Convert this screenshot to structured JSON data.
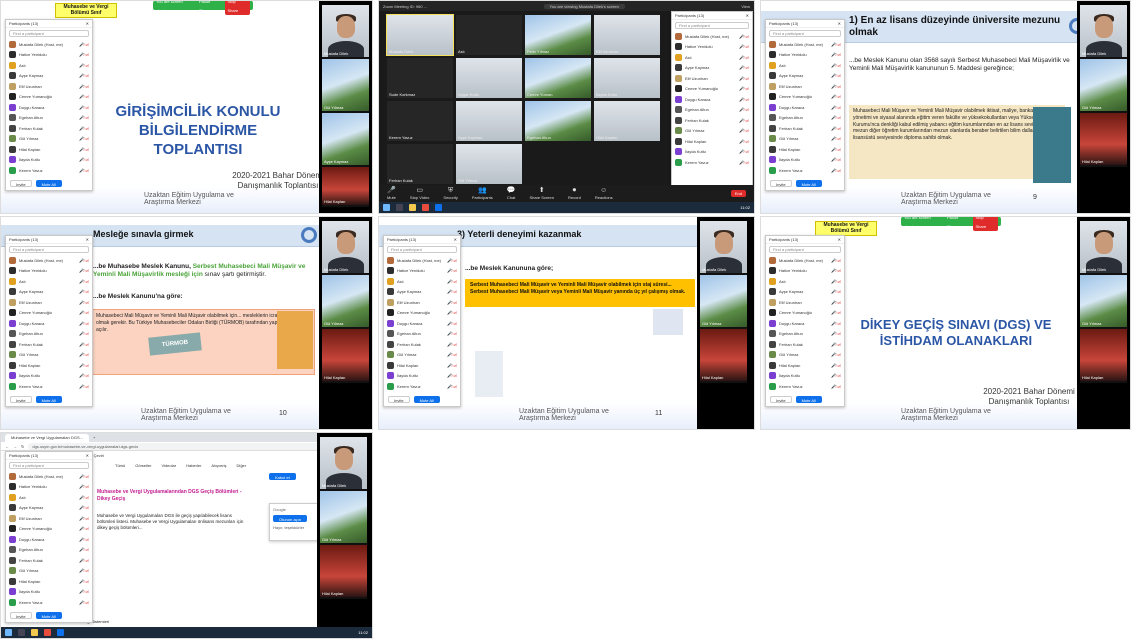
{
  "share_bar": {
    "sharing_label": "You are screen sharing",
    "pause_label": "Pause Share",
    "stop_label": "Stop Share"
  },
  "participants_panel": {
    "title": "Participants (13)",
    "search_placeholder": "Find a participant",
    "invite_label": "Invite",
    "mute_all_label": "Mute All",
    "rows": [
      {
        "name": "Mustafa Dilek (Host, me)",
        "color": "#b36a3a"
      },
      {
        "name": "Hatice Yenidolu",
        "color": "#2d2d2d"
      },
      {
        "name": "Aslı",
        "color": "#e0a020"
      },
      {
        "name": "Ayşe Kaymaz",
        "color": "#3a3a3a"
      },
      {
        "name": "Elif Uzunhan",
        "color": "#c0a060"
      },
      {
        "name": "Cemre Yumanoğlu",
        "color": "#222222"
      },
      {
        "name": "Duygu Karaca",
        "color": "#7a3ed1"
      },
      {
        "name": "Egehan Altun",
        "color": "#555555"
      },
      {
        "name": "Ferhan Kulak",
        "color": "#444444"
      },
      {
        "name": "Gül Yılmaz",
        "color": "#6a8a4a"
      },
      {
        "name": "Hilal Kaplan",
        "color": "#3a3a3a"
      },
      {
        "name": "İlayda Kutlu",
        "color": "#7a3ed1"
      },
      {
        "name": "Kerem Yavuz",
        "color": "#2a9d4a"
      }
    ]
  },
  "videos": {
    "host_name": "Mustafa Dilek",
    "second_name": "Ayşe Kaymaz",
    "third_name": "Hilal Kaplan",
    "fourth_name": "Gül Yılmaz"
  },
  "slides": {
    "s1": {
      "header": "Muhasebe ve Vergi Bölümü Sınıf",
      "title_line1": "GİRİŞİMCİLİK KONULU",
      "title_line2": "BİLGİLENDİRME TOPLANTISI",
      "date_line1": "2020-2021 Bahar Dönemi",
      "date_line2": "Danışmanlık Toplantısı",
      "footer_line1": "Uzaktan Eğitim Uygulama ve",
      "footer_line2": "Araştırma Merkezi"
    },
    "s3": {
      "header": "1) En az lisans düzeyinde üniversite mezunu olmak",
      "body": "...be Meslek Kanunu olan 3568 sayılı Serbest Muhasebeci Mali Müşavirlik ve Yeminli Mali Müşavirlik kanununun 5. Maddesi gereğince;",
      "box": "Muhasebeci Mali Müşavir ve Yeminli Mali Müşavir olabilmek iktisat, maliye, bankacılık, kamu yönetimi ve siyasal alanında eğitim veren fakülte ve yüksekokullardan veya Yükseköğretim Kurumu'nca denkliği kabul edilmiş yabancı eğitim kurumlarından en az lisans seviyesinde mezun diğer öğretim kurumlarından mezun olanlarda beraber belirtilen bilim dallarından lisansüstü seviyesinde diploma sahibi olmak.",
      "page": "9",
      "footer_line1": "Uzaktan Eğitim Uygulama ve",
      "footer_line2": "Araştırma Merkezi"
    },
    "s4": {
      "header": "Mesleğe sınavla girmek",
      "body1_a": "...be Muhasebe Meslek Kanunu, ",
      "body1_b": "Serbest Muhasebeci Mali Müşavir ve Yeminli Mali Müşavirlik mesleği için",
      "body1_c": " sınav şartı getirmiştir.",
      "body2": "...be Meslek Kanunu'na göre:",
      "box": "Muhasebeci Mali Müşavir ve Yeminli Mali Müşavir olabilmek için... mesleklerin icrasını kazanmış olmak gerekir. Bu Türkiye Muhasebeciler Odaları Birliği (TÜRMOB) tarafından yapılacak sınavlar açılır.",
      "badge": "TÜRMOB",
      "page": "10",
      "footer_line1": "Uzaktan Eğitim Uygulama ve",
      "footer_line2": "Araştırma Merkezi"
    },
    "s5": {
      "header": "3) Yeterli deneyimi kazanmak",
      "body": "...be Meslek Kanununa göre;",
      "box": "Serbest Muhasebeci Mali Müşavir ve Yeminli Mali Müşavir olabilmek için staj süresi... Serbest Muhasebeci Mali Müşavir veya Yeminli Mali Müşavir yanında üç yıl çalışmış olmak.",
      "page": "11",
      "footer_line1": "Uzaktan Eğitim Uygulama ve",
      "footer_line2": "Araştırma Merkezi"
    },
    "s6": {
      "header": "Muhasebe ve Vergi Bölümü Sınıf",
      "title_line1": "DİKEY GEÇİŞ SINAVI (DGS) VE",
      "title_line2": "İSTİHDAM OLANAKLARI",
      "date_line1": "2020-2021 Bahar Dönemi",
      "date_line2": "Danışmanlık Toplantısı",
      "footer_line1": "Uzaktan Eğitim Uygulama ve",
      "footer_line2": "Araştırma Merkezi"
    }
  },
  "zoom_gallery": {
    "window_title": "Zoom Meeting ID: 960 ...",
    "banner": "You are viewing Mustafa Dilek's screen",
    "view_label": "View",
    "participants_title": "Participants (13)",
    "tiles": [
      "Mustafa Dilek",
      "Aslı",
      "Pelin Yılmaz",
      "Elif Uzunhan",
      "Sude Korkmaz",
      "Uygar Kutlu",
      "Cemre Yuman",
      "İlayda Kutlu",
      "Kerem Yavuz",
      "Ayşe Kaymaz",
      "Egehan Altun",
      "Hilal Kaplan",
      "Ferhan Kulak",
      "Gül Yılmaz"
    ],
    "toolbar": [
      "Mute",
      "Stop Video",
      "Security",
      "Participants",
      "Chat",
      "Share Screen",
      "Record",
      "Reactions"
    ],
    "end_label": "End",
    "clock": "11:02"
  },
  "browser": {
    "tab_title": "Muhasebe ve Vergi Uygulamaları DGS...",
    "address": "dgs.osym.gov.tr/muhasebe-ve-vergi-uygulamalari-dgs-gecis",
    "bookmarks": [
      "Gmail",
      "YouTube",
      "Haritalar",
      "Haberler",
      "Çeviri"
    ],
    "search_tabs": [
      "Tümü",
      "Görseller",
      "Videolar",
      "Haberler",
      "Alışveriş",
      "Diğer"
    ],
    "page_heading": "Muhasebe ve Vergi Uygulamalarından DGS Geçiş Bölümleri - Dikey Geçiş",
    "snippet": "Muhasebe ve Vergi Uygulamaları DGS ile geçiş yapılabilecek lisans bölümleri listesi. Muhasebe ve Vergi Uygulamaları önlisans mezunları için dikey geçiş bölümleri...",
    "accept_label": "Kabul et",
    "popup_title": "Google",
    "popup_option1": "Oturum açın",
    "popup_option2": "Hayır, teşekkürler",
    "left_label": "Muhasebe Bilgi Sistemleri"
  },
  "colors": {
    "zoom_blue": "#0e71eb",
    "share_green": "#2fb14a",
    "stop_red": "#e02b2b",
    "slide_title_blue": "#2b56a6",
    "header_band": "#d5e3f3"
  }
}
